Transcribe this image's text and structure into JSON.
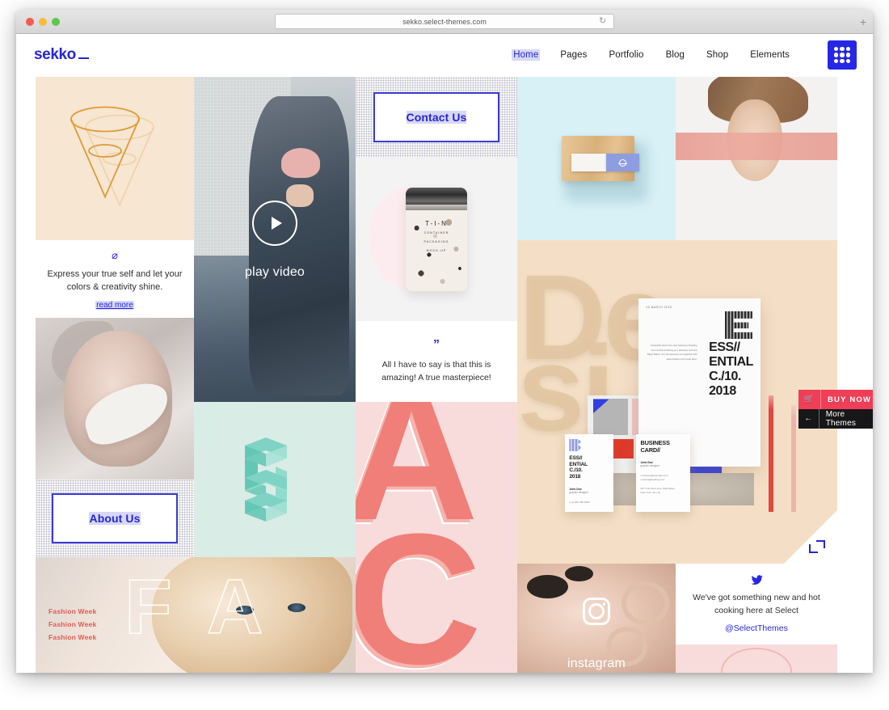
{
  "browser": {
    "url": "sekko.select-themes.com",
    "reload_icon": "reload-icon",
    "newtab_label": "+"
  },
  "header": {
    "logo": "sekko",
    "nav": [
      {
        "label": "Home",
        "active": true
      },
      {
        "label": "Pages",
        "active": false
      },
      {
        "label": "Portfolio",
        "active": false
      },
      {
        "label": "Blog",
        "active": false
      },
      {
        "label": "Shop",
        "active": false
      },
      {
        "label": "Elements",
        "active": false
      }
    ],
    "grid_button": "grid-menu-icon"
  },
  "tiles": {
    "cone": {
      "icon": "cone-illustration",
      "bg": "#f6e6d2"
    },
    "promo_text": {
      "icon": "planet-icon",
      "icon_glyph": "⌀",
      "copy": "Express your true self and let your colors & creativity shine.",
      "link": "read more"
    },
    "portrait": {
      "alt": "black-and-white-portrait"
    },
    "about": {
      "label": "About Us"
    },
    "fashion": {
      "labels": [
        "Fashion Week",
        "Fashion Week",
        "Fashion Week"
      ],
      "letters": [
        "F",
        "A"
      ]
    },
    "video": {
      "label": "play video",
      "play_icon": "play-icon"
    },
    "mint": {
      "alt": "isometric-s-logo",
      "bg": "#d9ece6"
    },
    "contact": {
      "label": "Contact Us"
    },
    "tin": {
      "title": "T-I-N",
      "sub1": "CONTAINER",
      "sub2": "PACKAGING",
      "sub3": "MOCK-UP"
    },
    "quote": {
      "mark": "”",
      "copy": "All I have to say is that this is amazing! A true masterpiece!"
    },
    "ac": {
      "letters": [
        "A",
        "C"
      ],
      "bg": "#f8dcdb"
    },
    "wood": {
      "alt": "business-cards-on-wood"
    },
    "upside": {
      "alt": "upside-down-portrait"
    },
    "design": {
      "bg_text_left": "De",
      "bg_text_right": "si",
      "poster_date": "20 MARCH 2018",
      "poster_title": "ESS//\nENTIAL\nC./10.\n2018",
      "poster_body": "A beautiful clean from view stationery branding and mockup including pen, business card and Paper Brand. You can add your own graphics with ease thanks to the smart layer.",
      "card1_title": "ESS//\nENTIAL\nC./10.\n2018",
      "card1_name": "John Doe",
      "card1_role": "graphic designer",
      "card1_meta": "(+1) 456 789 8833",
      "card2_title": "BUSINESS\nCARD//",
      "card2_name": "John Doe",
      "card2_role": "graphic designer",
      "card2_meta": "company@example.com\ncontact@leading.com\n\n207 Columbus Ave, Manhattan\nNew York, 38, US"
    },
    "instagram": {
      "label": "instagram",
      "icon": "instagram-icon"
    },
    "twitter": {
      "icon": "twitter-bird-icon",
      "copy": "We've got something new and hot cooking here at Select",
      "handle": "@SelectThemes"
    }
  },
  "cta": {
    "buy": {
      "label": "BUY NOW",
      "icon": "cart-icon",
      "color": "#ef3e56"
    },
    "more": {
      "label": "More Themes",
      "icon": "arrow-left-icon",
      "color": "#17171a"
    }
  },
  "colors": {
    "brand_blue": "#2626e6",
    "highlight": "#d7d7f8",
    "coral": "#ef7f78",
    "mint": "#d9ece6",
    "cream": "#f4dfc6"
  }
}
